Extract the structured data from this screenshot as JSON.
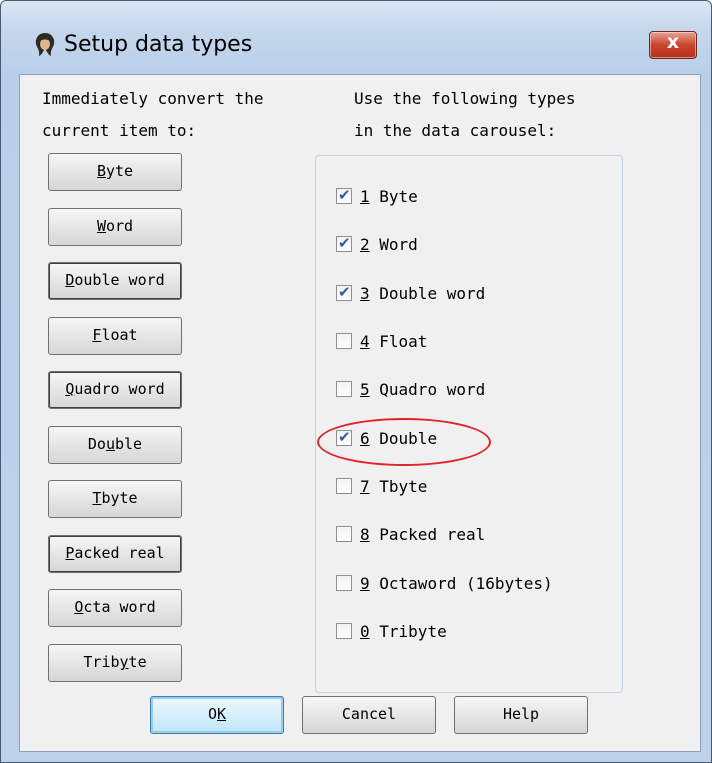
{
  "window": {
    "title": "Setup data types",
    "icon": "app-icon",
    "close_label": "x"
  },
  "left": {
    "heading_line1": "Immediately convert the",
    "heading_line2": "current item to:",
    "buttons": [
      {
        "pre": "",
        "key": "B",
        "post": "yte"
      },
      {
        "pre": "",
        "key": "W",
        "post": "ord"
      },
      {
        "pre": "",
        "key": "D",
        "post": "ouble word"
      },
      {
        "pre": "",
        "key": "F",
        "post": "loat"
      },
      {
        "pre": "",
        "key": "Q",
        "post": "uadro word"
      },
      {
        "pre": "Do",
        "key": "u",
        "post": "ble"
      },
      {
        "pre": "",
        "key": "T",
        "post": "byte"
      },
      {
        "pre": "",
        "key": "P",
        "post": "acked real"
      },
      {
        "pre": "",
        "key": "O",
        "post": "cta word"
      },
      {
        "pre": "Trib",
        "key": "y",
        "post": "te"
      }
    ]
  },
  "right": {
    "heading_line1": "Use the following types",
    "heading_line2": "in the data carousel:",
    "items": [
      {
        "key": "1",
        "label": " Byte",
        "checked": true
      },
      {
        "key": "2",
        "label": " Word",
        "checked": true
      },
      {
        "key": "3",
        "label": " Double word",
        "checked": true
      },
      {
        "key": "4",
        "label": " Float",
        "checked": false
      },
      {
        "key": "5",
        "label": " Quadro word",
        "checked": false
      },
      {
        "key": "6",
        "label": " Double",
        "checked": true
      },
      {
        "key": "7",
        "label": " Tbyte",
        "checked": false
      },
      {
        "key": "8",
        "label": " Packed real",
        "checked": false
      },
      {
        "key": "9",
        "label": " Octaword (16bytes)",
        "checked": false
      },
      {
        "key": "0",
        "label": " Tribyte",
        "checked": false
      }
    ]
  },
  "footer": {
    "ok": {
      "pre": "O",
      "key": "K",
      "post": ""
    },
    "cancel": "Cancel",
    "help": "Help"
  },
  "colors": {
    "highlight": "#e3222a",
    "check": "#3c5a9a"
  }
}
